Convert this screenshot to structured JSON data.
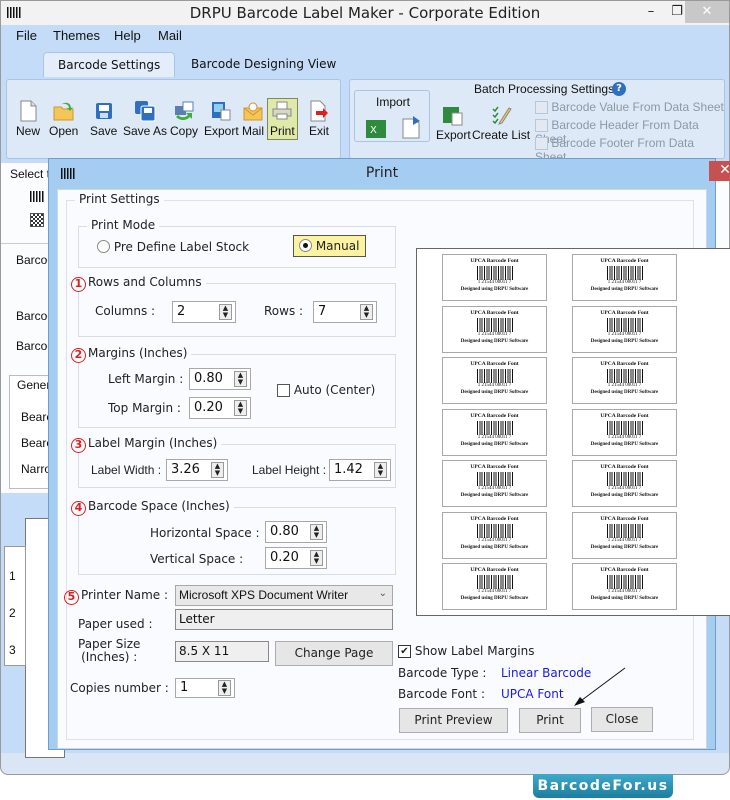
{
  "app": {
    "title": "DRPU Barcode Label Maker - Corporate Edition",
    "window_controls": {
      "minimize": "–",
      "maximize": "❐",
      "close": "✕"
    }
  },
  "menu": [
    "File",
    "Themes",
    "Help",
    "Mail"
  ],
  "ribbon_tabs": [
    {
      "label": "Barcode Settings",
      "active": true
    },
    {
      "label": "Barcode Designing View",
      "active": false
    }
  ],
  "toolbar": [
    {
      "label": "New",
      "icon": "new-document-icon"
    },
    {
      "label": "Open",
      "icon": "open-folder-icon"
    },
    {
      "label": "Save",
      "icon": "save-icon"
    },
    {
      "label": "Save As",
      "icon": "save-as-icon"
    },
    {
      "label": "Copy",
      "icon": "copy-icon"
    },
    {
      "label": "Export",
      "icon": "export-image-icon"
    },
    {
      "label": "Mail",
      "icon": "mail-icon"
    },
    {
      "label": "Print",
      "icon": "printer-icon",
      "active": true
    },
    {
      "label": "Exit",
      "icon": "exit-icon"
    }
  ],
  "batch": {
    "import_label": "Import",
    "title": "Batch Processing Settings",
    "export_label": "Export",
    "create_list_label": "Create List",
    "options": [
      "Barcode Value From Data Sheet",
      "Barcode Header From Data Sheet",
      "Barcode Footer From Data Sheet"
    ]
  },
  "background": {
    "select_text": "Select th",
    "rows": [
      "Barcod",
      "Barcod",
      "Barcod"
    ],
    "general_tab": "Genera",
    "list": [
      "Beare",
      "Beare",
      "Narro"
    ],
    "ruler": [
      "1",
      "2",
      "3"
    ]
  },
  "dialog": {
    "title": "Print",
    "close": "✕",
    "print_settings": "Print Settings",
    "print_mode": {
      "legend": "Print Mode",
      "options": [
        "Pre Define Label Stock",
        "Manual"
      ],
      "selected": "Manual"
    },
    "rows_columns": {
      "num": "1",
      "legend": "Rows and Columns",
      "columns_label": "Columns :",
      "columns": "2",
      "rows_label": "Rows :",
      "rows": "7"
    },
    "margins": {
      "num": "2",
      "legend": "Margins (Inches)",
      "left_label": "Left Margin :",
      "left": "0.80",
      "top_label": "Top Margin :",
      "top": "0.20",
      "auto_label": "Auto (Center)",
      "auto_checked": false
    },
    "label_margin": {
      "num": "3",
      "legend": "Label Margin (Inches)",
      "width_label": "Label Width :",
      "width": "3.26",
      "height_label": "Label Height :",
      "height": "1.42"
    },
    "barcode_space": {
      "num": "4",
      "legend": "Barcode Space (Inches)",
      "h_label": "Horizontal Space :",
      "h": "0.80",
      "v_label": "Vertical Space :",
      "v": "0.20"
    },
    "printer": {
      "num": "5",
      "label": "Printer Name :",
      "value": "Microsoft XPS Document Writer",
      "paper_used_label": "Paper used :",
      "paper_used": "Letter",
      "paper_size_label_1": "Paper Size",
      "paper_size_label_2": "(Inches) :",
      "paper_size": "8.5 X 11",
      "change_page": "Change Page",
      "copies_label": "Copies number :",
      "copies": "1"
    },
    "show_margins_label": "Show Label Margins",
    "show_margins_checked": true,
    "barcode_type_label": "Barcode Type :",
    "barcode_type": "Linear Barcode",
    "barcode_font_label": "Barcode Font :",
    "barcode_font": "UPCA Font",
    "buttons": {
      "preview": "Print Preview",
      "print": "Print",
      "close": "Close"
    },
    "preview_label": {
      "header": "UPCA Barcode Font",
      "number": "1  21544  00011  7",
      "footer": "Designed using DRPU Software"
    }
  },
  "watermark": "BarcodeFor.us"
}
